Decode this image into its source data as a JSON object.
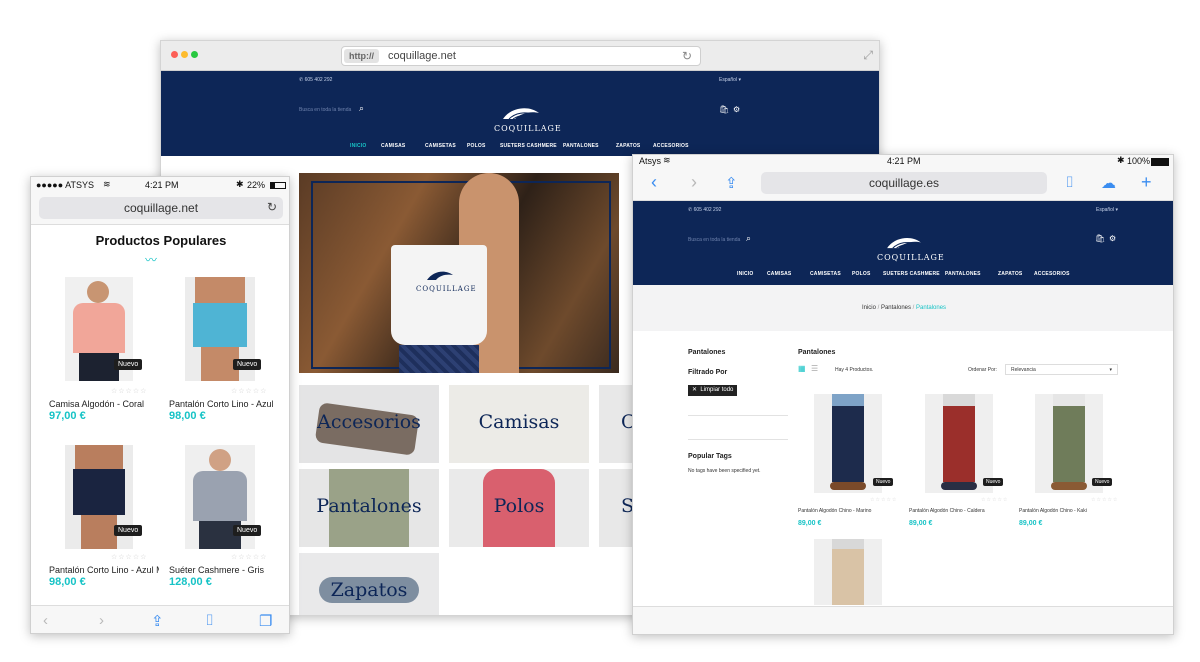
{
  "colors": {
    "navy": "#0d2657",
    "teal": "#17c3c6",
    "badge": "#1e1e1e"
  },
  "desktop": {
    "window_controls": [
      "close-dot",
      "minimize-dot",
      "zoom-dot"
    ],
    "url_protocol": "http://",
    "url_host": "coquillage.net",
    "site": {
      "phone": "605 402 292",
      "language": "Español",
      "search_placeholder": "Busca en toda la tienda",
      "logo_text": "COQUILLAGE",
      "menu": [
        "INICIO",
        "CAMISAS",
        "CAMISETAS",
        "POLOS",
        "SUETERS CASHMERE",
        "PANTALONES",
        "ZAPATOS",
        "ACCESORIOS"
      ],
      "hero_bag_text": "COQUILLAGE",
      "categories": [
        "Accesorios",
        "Camisas",
        "C",
        "Pantalones",
        "Polos",
        "S",
        "Zapatos"
      ]
    }
  },
  "phone": {
    "carrier": "●●●●● ATSYS",
    "time": "4:21 PM",
    "battery": "22%",
    "url": "coquillage.net",
    "section_title": "Productos Populares",
    "badge": "Nuevo",
    "stars": "☆☆☆☆☆",
    "products": [
      {
        "name": "Camisa Algodón - Coral",
        "price": "97,00 €"
      },
      {
        "name": "Pantalón Corto Lino - Azul C",
        "price": "98,00 €"
      },
      {
        "name": "Pantalón Corto Lino - Azul M",
        "price": "98,00 €"
      },
      {
        "name": "Suéter Cashmere - Gris",
        "price": "128,00 €"
      }
    ]
  },
  "tablet": {
    "carrier": "Atsys",
    "time": "4:21 PM",
    "battery": "100%",
    "url": "coquillage.es",
    "site": {
      "phone": "605 402 292",
      "language": "Español",
      "search_placeholder": "Busca en toda la tienda",
      "logo_text": "COQUILLAGE",
      "menu": [
        "INICIO",
        "CAMISAS",
        "CAMISETAS",
        "POLOS",
        "SUETERS CASHMERE",
        "PANTALONES",
        "ZAPATOS",
        "ACCESORIOS"
      ]
    },
    "breadcrumb": {
      "home": "Inicio",
      "sep": "/",
      "parent": "Pantalones",
      "current": "Pantalones"
    },
    "sidebar": {
      "category": "Pantalones",
      "filter_title": "Filtrado Por",
      "clear_all": "Limpiar todo",
      "tags_title": "Popular Tags",
      "tags_empty": "No tags have been specified yet."
    },
    "content": {
      "title": "Pantalones",
      "count": "Hay 4 Productos.",
      "sort_label": "Ordenar Por:",
      "sort_value": "Relevancia",
      "badge": "Nuevo",
      "stars": "☆☆☆☆☆",
      "products": [
        {
          "name": "Pantalón Algodón Chino - Marino",
          "price": "89,00 €"
        },
        {
          "name": "Pantalón Algodón Chino - Caldera",
          "price": "89,00 €"
        },
        {
          "name": "Pantalón Algodón Chino - Kaki",
          "price": "89,00 €"
        }
      ]
    }
  }
}
